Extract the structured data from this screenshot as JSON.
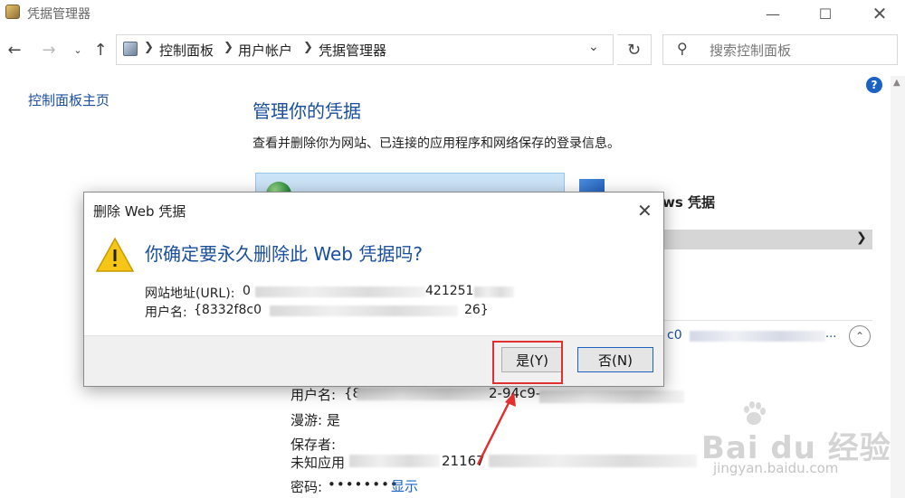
{
  "window": {
    "title": "凭据管理器"
  },
  "address": {
    "crumbs": [
      "控制面板",
      "用户帐户",
      "凭据管理器"
    ],
    "search_placeholder": "搜索控制面板"
  },
  "nav": {
    "home_link": "控制面板主页"
  },
  "main": {
    "heading": "管理你的凭据",
    "description": "查看并删除你为网站、已连接的应用程序和网络保存的登录信息。",
    "windows_cred_label": "ws 凭据",
    "entry_text": "c0",
    "entry_ellipsis": "...",
    "details": {
      "username_label": "用户名:",
      "username_prefix": "{8",
      "username_fragment": "2-94c9-",
      "roaming": "漫游: 是",
      "saved_by_label": "保存者:",
      "saved_by_value_prefix": "未知应用",
      "saved_by_fragment": "21167",
      "password_label": "密码:",
      "password_mask": "••••••••",
      "show_link": "显示"
    }
  },
  "dialog": {
    "title": "删除 Web 凭据",
    "heading": "你确定要永久删除此 Web 凭据吗?",
    "url_label": "网站地址(URL): ",
    "url_prefix": "0",
    "url_fragment": "421251",
    "user_label": "用户名: ",
    "user_prefix": "{8332f8c0",
    "user_suffix": "26}",
    "yes_button": "是(Y)",
    "no_button": "否(N)"
  },
  "watermark": {
    "brand": "Bai du 经验",
    "url": "jingyan.baidu.com"
  },
  "colors": {
    "link": "#1a4fa0",
    "highlight": "#e03030",
    "tile": "#cce4f7"
  }
}
